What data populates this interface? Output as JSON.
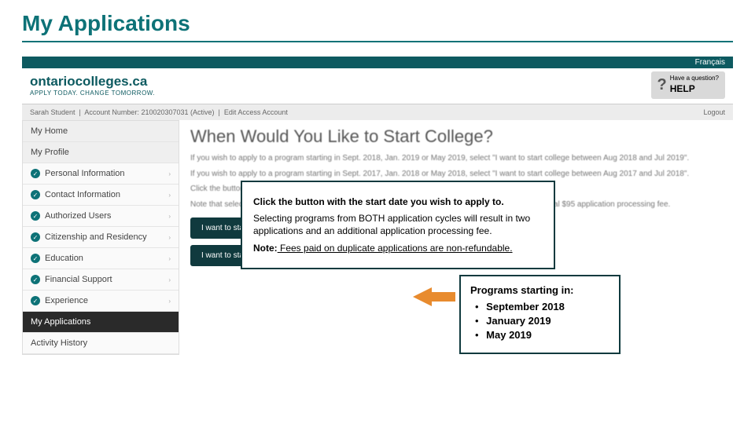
{
  "slide": {
    "title": "My Applications"
  },
  "topbar": {
    "lang": "Français"
  },
  "brand": {
    "name": "ontariocolleges.ca",
    "tagline": "APPLY TODAY. CHANGE TOMORROW."
  },
  "help": {
    "question_mark": "?",
    "label": "Have a question?",
    "cta": "HELP"
  },
  "account": {
    "name": "Sarah Student",
    "number_label": "Account Number",
    "number": "210020307031",
    "status": "(Active)",
    "edit": "Edit Access Account",
    "logout": "Logout"
  },
  "sidebar": {
    "home": "My Home",
    "profile": "My Profile",
    "items": [
      "Personal Information",
      "Contact Information",
      "Authorized Users",
      "Citizenship and Residency",
      "Education",
      "Financial Support",
      "Experience"
    ],
    "active": "My Applications",
    "last": "Activity History"
  },
  "main": {
    "heading": "When Would You Like to Start College?",
    "p1": "If you wish to apply to a program starting in Sept. 2018, Jan. 2019 or May 2019, select \"I want to start college between Aug 2018 and Jul 2019\".",
    "p2": "If you wish to apply to a program starting in Sept. 2017, Jan. 2018 or May 2018, select \"I want to start college between Aug 2017 and Jul 2018\".",
    "p3": "Click the button below with the start date you wish to apply to.",
    "p4": "Note that selecting programs from BOTH application cycles will result in two applications and an additional $95 application processing fee.",
    "btn1": "I want to start college between Aug 2018 and Jul 2019",
    "btn2": "I want to start college between Aug 2017 and Jul 2018"
  },
  "callout1": {
    "line1": "Click the button with the start date you wish to apply to.",
    "line2": "Selecting programs from BOTH application cycles will result in two applications and an additional application processing fee.",
    "line3_prefix": "Note:",
    "line3_rest": " Fees paid on duplicate applications are non-refundable."
  },
  "callout2": {
    "header": "Programs starting in:",
    "items": [
      "September 2018",
      "January 2019",
      "May 2019"
    ]
  }
}
